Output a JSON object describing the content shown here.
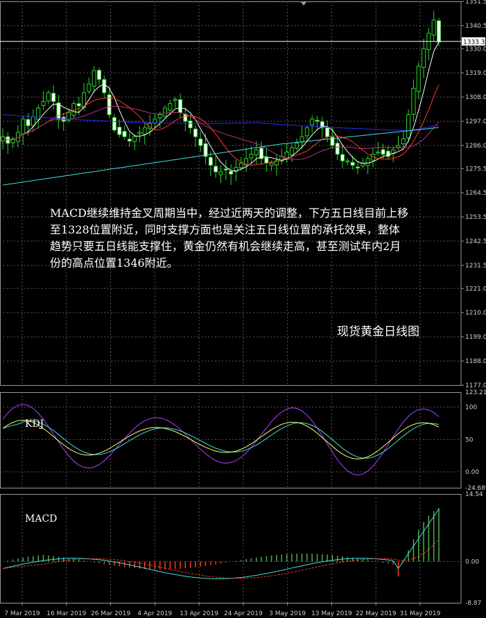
{
  "chart_data": [
    {
      "type": "candlestick",
      "instrument_note": "现货黄金日线图",
      "annotation": "MACD继续维持金叉周期当中，经过近两天的调整，下方五日线目前上移至1328位置附近，同时支撑方面也是关注五日线位置的承托效果，整体趋势只要五日线能支撑住，黄金仍然有机会继续走高，甚至测试年内2月份的高点位置1346附近。",
      "current_price_label": "1333.3",
      "y_ticks": [
        "1351.5",
        "1340.5",
        "1330.0",
        "1319.0",
        "1308.0",
        "1297.0",
        "1286.0",
        "1275.5",
        "1264.5",
        "1253.5",
        "1242.5",
        "1231.5",
        "1221.0",
        "1210.0",
        "1199.0",
        "1188.0",
        "1177.0"
      ],
      "ylim": [
        1177.0,
        1351.5
      ],
      "x_ticks": [
        "7 Mar 2019",
        "16 Mar 2019",
        "26 Mar 2019",
        "4 Apr 2019",
        "13 Apr 2019",
        "24 Apr 2019",
        "3 May 2019",
        "13 May 2019",
        "22 May 2019",
        "31 May 2019"
      ],
      "grid": true,
      "candles_close": [
        1290,
        1287,
        1289,
        1292,
        1298,
        1295,
        1299,
        1303,
        1306,
        1310,
        1306,
        1298,
        1297,
        1301,
        1305,
        1304,
        1310,
        1314,
        1320,
        1316,
        1310,
        1300,
        1293,
        1291,
        1290,
        1288,
        1290,
        1292,
        1294,
        1296,
        1298,
        1300,
        1303,
        1305,
        1307,
        1301,
        1297,
        1294,
        1290,
        1286,
        1281,
        1277,
        1274,
        1274,
        1275,
        1273,
        1276,
        1278,
        1280,
        1282,
        1284,
        1280,
        1278,
        1278,
        1279,
        1281,
        1283,
        1285,
        1287,
        1290,
        1294,
        1298,
        1297,
        1294,
        1290,
        1286,
        1282,
        1279,
        1279,
        1277,
        1276,
        1278,
        1280,
        1282,
        1283,
        1282,
        1281,
        1284,
        1286,
        1289,
        1300,
        1312,
        1322,
        1330,
        1337,
        1343,
        1333
      ],
      "series": [
        {
          "name": "MA5",
          "color": "#ffffff"
        },
        {
          "name": "MA10",
          "color": "#ff3b1f"
        },
        {
          "name": "MA20",
          "color": "#c0307a"
        },
        {
          "name": "MA60",
          "color": "#2a2aff"
        },
        {
          "name": "MA120",
          "color": "#40e0e0"
        }
      ]
    },
    {
      "type": "line",
      "title": "KDJ",
      "y_ticks": [
        "123.217",
        "100",
        "50",
        "0.00",
        "-24.689"
      ],
      "ylim": [
        -24.689,
        123.217
      ],
      "series": [
        {
          "name": "K",
          "color": "#ffff66"
        },
        {
          "name": "D",
          "color": "#40e0e0"
        },
        {
          "name": "J",
          "color": "#b040ff"
        }
      ]
    },
    {
      "type": "bar+line",
      "title": "MACD",
      "y_ticks": [
        "14.54",
        "0.00",
        "-8.87"
      ],
      "ylim": [
        -8.87,
        14.54
      ],
      "series": [
        {
          "name": "DIF",
          "color": "#40e0e0"
        },
        {
          "name": "DEA",
          "color": "#ff3b1f"
        },
        {
          "name": "Histogram",
          "color": "#4caf50"
        }
      ]
    }
  ]
}
